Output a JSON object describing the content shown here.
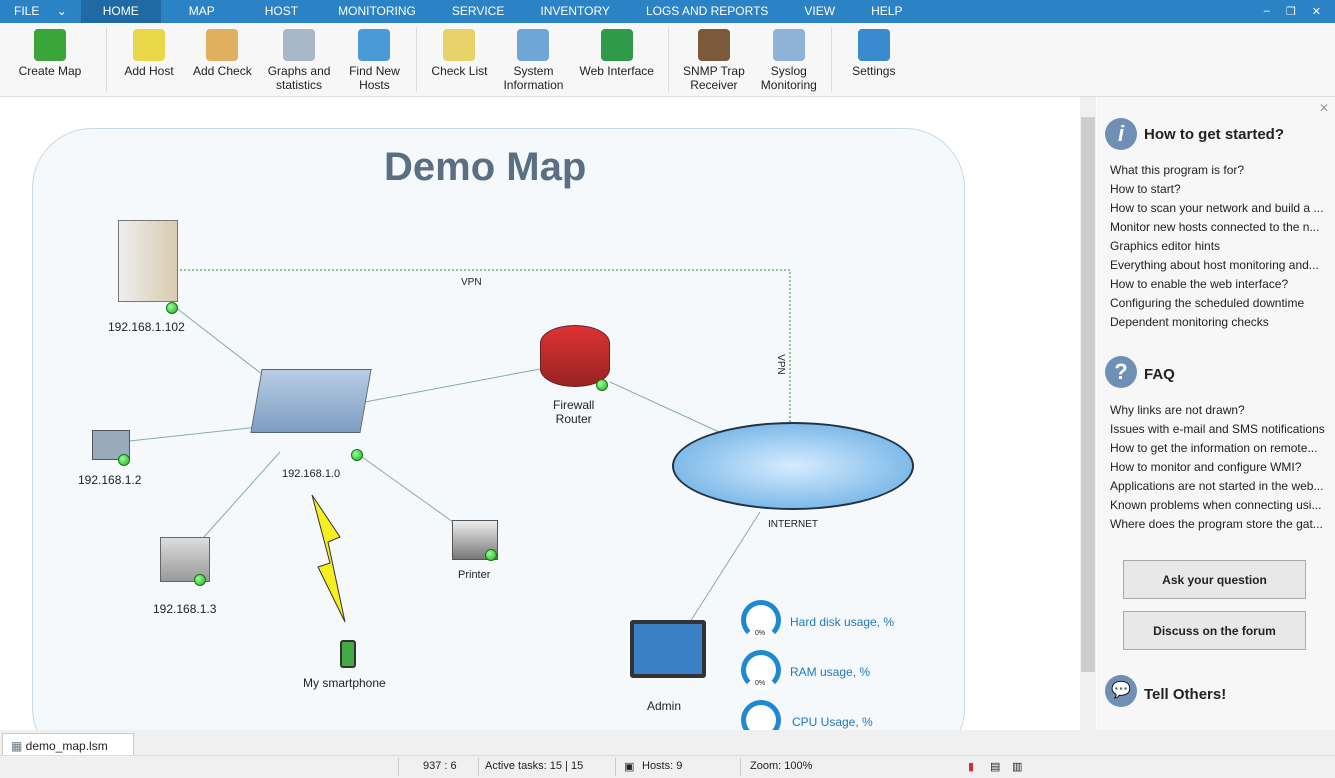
{
  "menu": {
    "items": [
      "FILE",
      "HOME",
      "MAP",
      "HOST",
      "MONITORING",
      "SERVICE",
      "INVENTORY",
      "LOGS AND REPORTS",
      "VIEW",
      "HELP"
    ],
    "active": "HOME",
    "window_controls": [
      "–",
      "❐",
      "✕"
    ]
  },
  "ribbon": {
    "buttons": [
      {
        "label": "Create Map",
        "icon": "create-map-icon",
        "color": "#3aa53a"
      },
      {
        "label": "Add Host",
        "icon": "add-host-icon",
        "color": "#e8d84a"
      },
      {
        "label": "Add Check",
        "icon": "add-check-icon",
        "color": "#e0b060"
      },
      {
        "label": "Graphs and\nstatistics",
        "icon": "graphs-icon",
        "color": "#a9b8c8"
      },
      {
        "label": "Find New\nHosts",
        "icon": "find-hosts-icon",
        "color": "#4a9ad8"
      },
      {
        "label": "Check List",
        "icon": "check-list-icon",
        "color": "#e8d36a"
      },
      {
        "label": "System\nInformation",
        "icon": "system-info-icon",
        "color": "#6fa6d8"
      },
      {
        "label": "Web Interface",
        "icon": "globe-icon",
        "color": "#2e9a4a"
      },
      {
        "label": "SNMP Trap\nReceiver",
        "icon": "snmp-trap-icon",
        "color": "#7a5a3a"
      },
      {
        "label": "Syslog\nMonitoring",
        "icon": "syslog-icon",
        "color": "#8fb3d6"
      },
      {
        "label": "Settings",
        "icon": "gear-icon",
        "color": "#3a8ad0"
      }
    ]
  },
  "map": {
    "title": "Demo Map",
    "vpn_label": "VPN",
    "nodes": [
      {
        "label": "192.168.1.102",
        "icon": "server-icon"
      },
      {
        "label": "192.168.1.0",
        "icon": "switch-icon"
      },
      {
        "label": "Firewall\nRouter",
        "icon": "router-icon"
      },
      {
        "label": "192.168.1.2",
        "icon": "workstation-icon"
      },
      {
        "label": "192.168.1.3",
        "icon": "plotter-icon"
      },
      {
        "label": "Printer",
        "icon": "printer-icon"
      },
      {
        "label": "My smartphone",
        "icon": "smartphone-icon"
      },
      {
        "label": "INTERNET",
        "icon": "cloud-icon"
      },
      {
        "label": "Admin",
        "icon": "laptop-icon"
      }
    ],
    "gauges": [
      {
        "label": "Hard disk usage, %",
        "value": "0%"
      },
      {
        "label": "RAM usage, %",
        "value": "0%"
      },
      {
        "label": "CPU Usage, %",
        "value": "0%"
      }
    ]
  },
  "panel": {
    "started": {
      "title": "How to get started?",
      "links": [
        "What this program is for?",
        "How to start?",
        "How to scan your network and build a ...",
        "Monitor new hosts connected to the n...",
        "Graphics editor hints",
        "Everything about host monitoring and...",
        "How to enable the web interface?",
        "Configuring the scheduled downtime",
        "Dependent monitoring checks"
      ]
    },
    "faq": {
      "title": "FAQ",
      "links": [
        "Why links are not drawn?",
        "Issues with e-mail and SMS notifications",
        "How to get the information on remote...",
        "How to monitor and configure WMI?",
        "Applications are not started in the web...",
        "Known problems when connecting usi...",
        "Where does the program store the gat..."
      ]
    },
    "ask_button": "Ask your question",
    "forum_button": "Discuss on the forum",
    "tell_title": "Tell Others!"
  },
  "tab": {
    "label": "demo_map.lsm"
  },
  "status": {
    "coords": "937 : 6",
    "tasks": "Active tasks: 15 | 15",
    "hosts": "Hosts: 9",
    "zoom": "Zoom: 100%"
  }
}
